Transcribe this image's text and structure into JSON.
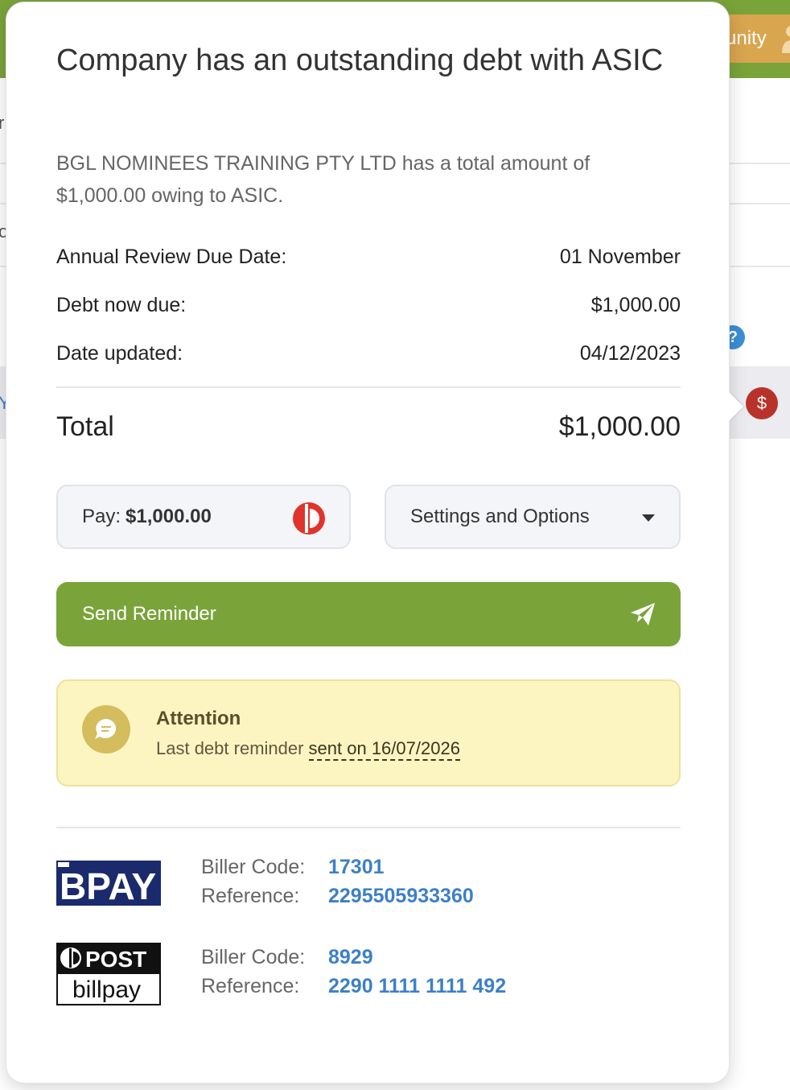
{
  "background": {
    "community_fragment": "unity",
    "help_glyph": "?",
    "dollar_glyph": "$",
    "left_fragments": [
      "r",
      "o",
      "Y"
    ]
  },
  "popover": {
    "title": "Company has an outstanding debt with ASIC",
    "description": "BGL NOMINEES TRAINING PTY LTD has a total amount of $1,000.00 owing to ASIC.",
    "details": [
      {
        "label": "Annual Review Due Date:",
        "value": "01 November"
      },
      {
        "label": "Debt now due:",
        "value": "$1,000.00"
      },
      {
        "label": "Date updated:",
        "value": "04/12/2023"
      }
    ],
    "total": {
      "label": "Total",
      "value": "$1,000.00"
    },
    "pay_button": {
      "prefix": "Pay:",
      "amount": "$1,000.00",
      "icon": "australia-post-icon"
    },
    "settings_button": {
      "label": "Settings and Options",
      "icon": "chevron-down-icon"
    },
    "send_reminder": {
      "label": "Send Reminder",
      "icon": "paper-plane-icon"
    },
    "attention": {
      "title": "Attention",
      "text": "Last debt reminder ",
      "link": "sent on 16/07/2026",
      "icon": "chat-bubble-icon"
    },
    "payment_methods": [
      {
        "logo": "BPAY",
        "labels": [
          "Biller Code:",
          "Reference:"
        ],
        "biller_code": "17301",
        "reference": "2295505933360"
      },
      {
        "logo_top": "POST",
        "logo_bottom": "billpay",
        "labels": [
          "Biller Code:",
          "Reference:"
        ],
        "biller_code": "8929",
        "reference": "2290 1111 1111 492"
      }
    ]
  },
  "colors": {
    "brand_green": "#7aa33a",
    "link_blue": "#3d7fc8",
    "attention_bg": "#fdf5c1",
    "danger_red": "#b8322a"
  }
}
